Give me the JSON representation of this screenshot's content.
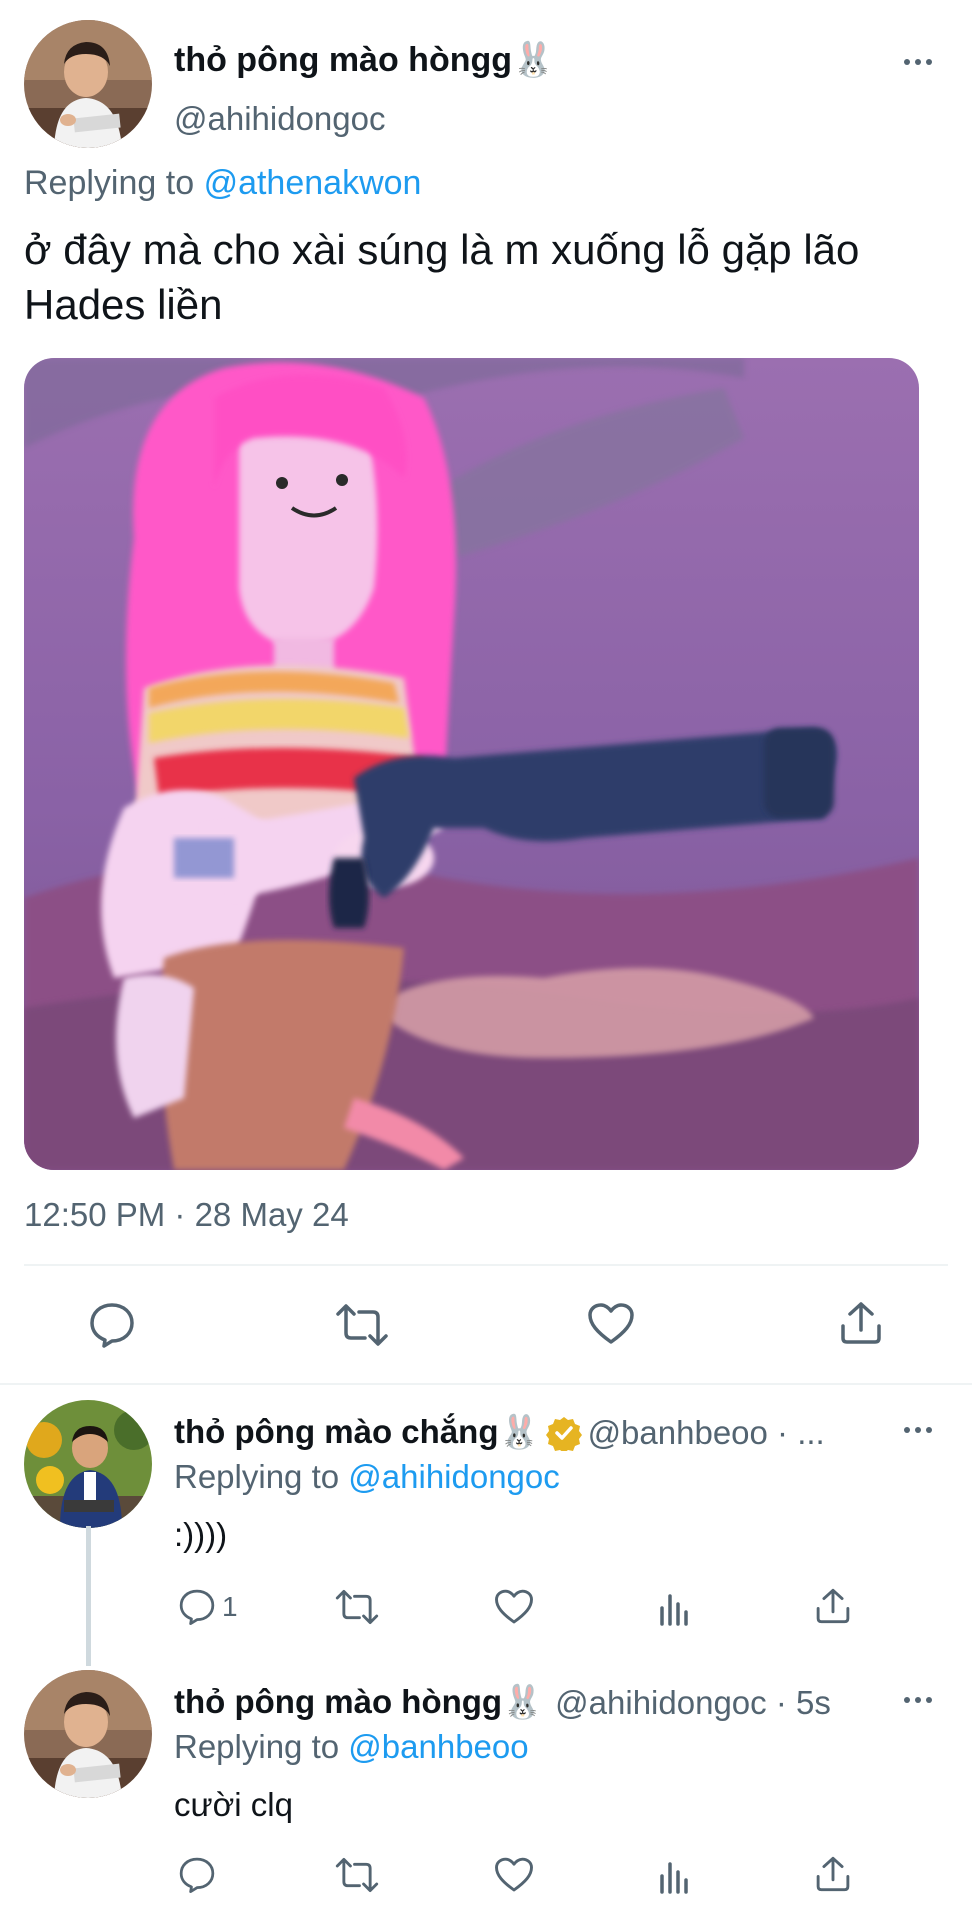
{
  "main_tweet": {
    "author_name": "thỏ pông mào hòngg🐰",
    "author_handle": "@ahihidongoc",
    "replying_prefix": "Replying to",
    "replying_to": "@athenakwon",
    "text": "ở đây mà cho xài súng là m xuống lỗ gặp lão Hades liền",
    "timestamp": "12:50 PM · 28 May 24",
    "actions": [
      "reply-icon",
      "retweet-icon",
      "like-icon",
      "share-icon"
    ]
  },
  "replies": [
    {
      "author_name": "thỏ pông mào chắng🐰",
      "verified": true,
      "author_handle": "@banhbeoo · ...",
      "replying_prefix": "Replying to",
      "replying_to": "@ahihidongoc",
      "text": ":))))",
      "reply_count": "1"
    },
    {
      "author_name": "thỏ pông mào hòngg🐰",
      "verified": false,
      "author_handle": "@ahihidongoc · 5s",
      "replying_prefix": "Replying to",
      "replying_to": "@banhbeoo",
      "text": "cười clq",
      "reply_count": ""
    }
  ],
  "colors": {
    "link": "#1d9bf0",
    "muted": "#536471",
    "divider": "#eff3f4",
    "verified_badge": "#e6b422"
  }
}
